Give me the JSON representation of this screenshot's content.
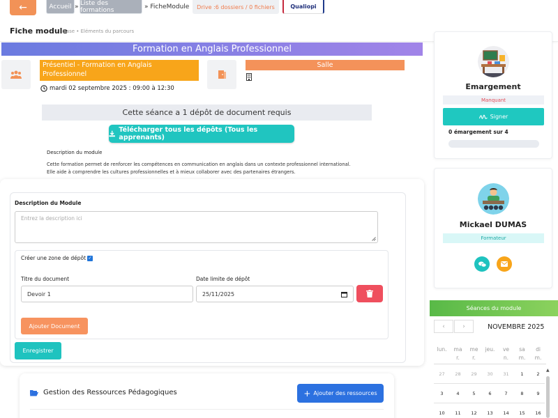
{
  "topbar": {
    "back_arrow": "←",
    "breadcrumbs": [
      "Accueil",
      "Liste des formations"
    ],
    "separator": "»",
    "current": "» FicheModule",
    "drive": "Drive :6 dossiers / 0 fichiers",
    "qualiopi": "Qualiopi"
  },
  "subheader": {
    "title": "Fiche module",
    "breadcrumb": "Base  •  Eléments du parcours"
  },
  "session": {
    "banner": "Formation en Anglais Professionnel",
    "type_label": "Présentiel - Formation en Anglais Professionnel",
    "room_label": "Salle",
    "date": "mardi 02 septembre 2025 : 09:00 à 12:30",
    "deposit_notice": "Cette séance a 1 dépôt de document requis",
    "download_button": "Télécharger tous les dépôts (Tous les apprenants)",
    "description_title": "Description du module",
    "description_lines": [
      "Cette formation permet de renforcer les compétences en communication en anglais dans un contexte professionnel international.",
      "Elle aide à comprendre les cultures professionnelles et à mieux collaborer avec des partenaires étrangers."
    ]
  },
  "form": {
    "description_label": "Description du Module",
    "description_placeholder": "Entrez la description ici",
    "deposit_zone_label": "Créer une zone de dépôt",
    "deposit_zone_checked": true,
    "doc_title_label": "Titre du document",
    "doc_title_value": "Devoir 1",
    "deadline_label": "Date limite de dépôt",
    "deadline_value": "25/11/2025",
    "add_doc_button": "Ajouter Document",
    "save_button": "Enregistrer"
  },
  "resources": {
    "title": "Gestion des Ressources Pédagogiques",
    "add_button": "Ajouter des ressources"
  },
  "emargement": {
    "title": "Emargement",
    "status": "Manquant",
    "sign_button": "Signer",
    "count": "0 émargement sur 4",
    "progress": 0
  },
  "trainer": {
    "name": "Mickael DUMAS",
    "role": "Formateur"
  },
  "calendar": {
    "header": "Séances du module",
    "prev": "‹",
    "next": "›",
    "month": "NOVEMBRE 2025",
    "weekdays": [
      [
        "lun."
      ],
      [
        "ma",
        "r."
      ],
      [
        "me",
        "r."
      ],
      [
        "jeu."
      ],
      [
        "ve",
        "n."
      ],
      [
        "sa",
        "m."
      ],
      [
        "di",
        "m."
      ]
    ],
    "weeks": [
      [
        "27",
        "28",
        "29",
        "30",
        "31",
        "1",
        "2"
      ],
      [
        "3",
        "4",
        "5",
        "6",
        "7",
        "8",
        "9"
      ],
      [
        "10",
        "11",
        "12",
        "13",
        "14",
        "15",
        "16"
      ]
    ],
    "muted_days_first_week": 5
  },
  "colors": {
    "orange": "#f29257",
    "teal": "#1fc3bf",
    "blue": "#2c71e0",
    "red": "#ef4f5e",
    "yellow": "#f8a51a",
    "green": "#58b947"
  }
}
